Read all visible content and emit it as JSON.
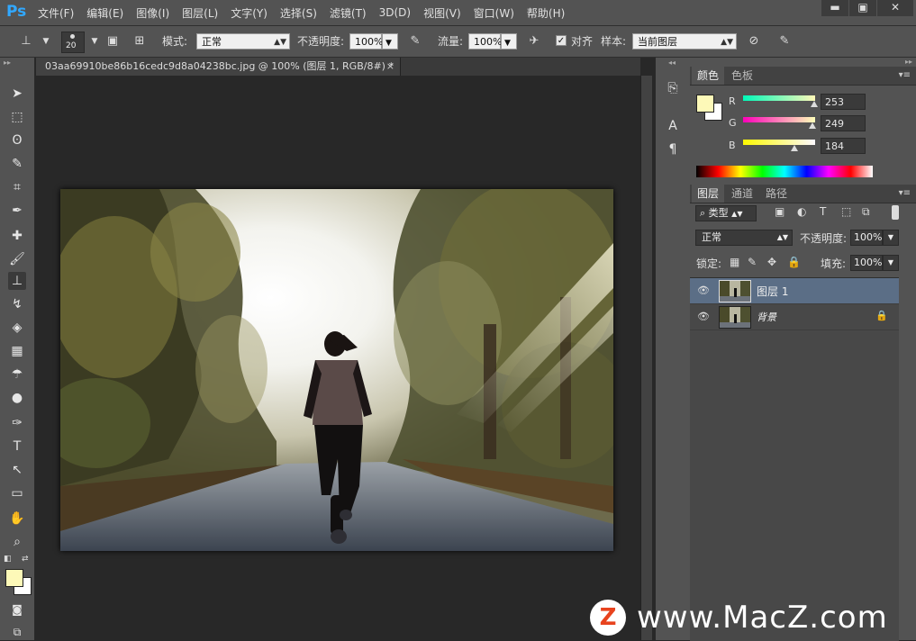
{
  "app": {
    "logo": "Ps",
    "title_file": "03aa69910be86b16cedc9d8a04238bc.jpg @ 100% (图层 1, RGB/8#) *"
  },
  "menu": [
    "文件(F)",
    "编辑(E)",
    "图像(I)",
    "图层(L)",
    "文字(Y)",
    "选择(S)",
    "滤镜(T)",
    "3D(D)",
    "视图(V)",
    "窗口(W)",
    "帮助(H)"
  ],
  "window_buttons": {
    "minimize": "▬",
    "maximize": "▣",
    "close": "✕"
  },
  "options": {
    "brush_size": "20",
    "mode_label": "模式:",
    "mode_value": "正常",
    "opacity_label": "不透明度:",
    "opacity_value": "100%",
    "flow_label": "流量:",
    "flow_value": "100%",
    "align_label": "对齐",
    "sample_label": "样本:",
    "sample_value": "当前图层"
  },
  "document_tab": {
    "title": "03aa69910be86b16cedc9d8a04238bc.jpg @ 100% (图层 1, RGB/8#) *",
    "close": "×"
  },
  "toolbar": [
    {
      "name": "move-tool-icon",
      "glyph": "➤"
    },
    {
      "name": "marquee-tool-icon",
      "glyph": "⬚"
    },
    {
      "name": "lasso-tool-icon",
      "glyph": "ʘ"
    },
    {
      "name": "quick-selection-tool-icon",
      "glyph": "✎"
    },
    {
      "name": "crop-tool-icon",
      "glyph": "⌗"
    },
    {
      "name": "eyedropper-tool-icon",
      "glyph": "✒"
    },
    {
      "name": "healing-brush-tool-icon",
      "glyph": "✚"
    },
    {
      "name": "brush-tool-icon",
      "glyph": "🖌"
    },
    {
      "name": "clone-stamp-tool-icon",
      "glyph": "⊥"
    },
    {
      "name": "history-brush-tool-icon",
      "glyph": "↯"
    },
    {
      "name": "eraser-tool-icon",
      "glyph": "◈"
    },
    {
      "name": "gradient-tool-icon",
      "glyph": "▦"
    },
    {
      "name": "blur-tool-icon",
      "glyph": "☂"
    },
    {
      "name": "dodge-tool-icon",
      "glyph": "●"
    },
    {
      "name": "pen-tool-icon",
      "glyph": "✑"
    },
    {
      "name": "type-tool-icon",
      "glyph": "T"
    },
    {
      "name": "path-selection-tool-icon",
      "glyph": "↖"
    },
    {
      "name": "shape-tool-icon",
      "glyph": "▭"
    },
    {
      "name": "hand-tool-icon",
      "glyph": "✋"
    },
    {
      "name": "zoom-tool-icon",
      "glyph": "⌕"
    }
  ],
  "colors": {
    "foreground": "#fdf9b8",
    "background": "#ffffff",
    "accent": "#31a8ff"
  },
  "color_panel": {
    "tabs": [
      "颜色",
      "色板"
    ],
    "r_label": "R",
    "r_value": "253",
    "g_label": "G",
    "g_value": "249",
    "b_label": "B",
    "b_value": "184"
  },
  "layers_panel": {
    "tabs": [
      "图层",
      "通道",
      "路径"
    ],
    "filter_label": "类型",
    "blend_mode": "正常",
    "opacity_label": "不透明度:",
    "opacity_value": "100%",
    "lock_label": "锁定:",
    "fill_label": "填充:",
    "fill_value": "100%",
    "layers": [
      {
        "name": "图层 1",
        "selected": true
      },
      {
        "name": "背景",
        "selected": false,
        "locked": true
      }
    ]
  },
  "watermark": {
    "logo": "Z",
    "text": "www.MacZ.com"
  }
}
